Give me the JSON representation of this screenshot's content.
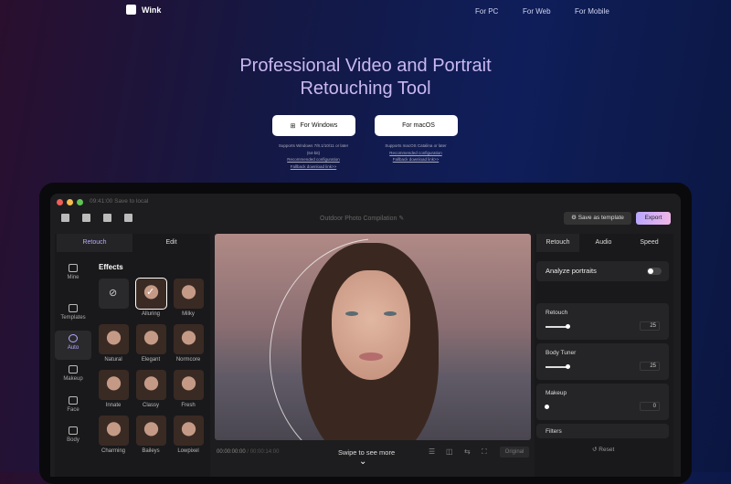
{
  "brand": {
    "name": "Wink"
  },
  "nav": [
    "For PC",
    "For Web",
    "For Mobile"
  ],
  "hero": {
    "line1": "Professional Video and Portrait",
    "line2": "Retouching Tool"
  },
  "downloads": [
    {
      "label": "For Windows",
      "icon": "windows-icon",
      "support": "Supports Windows 7/8.1/10/11 or later (64-bit)",
      "config": "Recommended configuration",
      "fallback": "Fallback download link>>"
    },
    {
      "label": "For macOS",
      "icon": "apple-icon",
      "support": "Supports macOS Catalina or later",
      "config": "Recommended configuration",
      "fallback": "Fallback download link>>"
    }
  ],
  "app": {
    "status": "09:41:00 Save to local",
    "project_title": "Outdoor Photo Compilation",
    "save_template": "Save as template",
    "export": "Export",
    "left_tabs": [
      "Retouch",
      "Edit"
    ],
    "sidebar": [
      "Mine",
      "Templates",
      "Auto",
      "Makeup",
      "Face",
      "Body"
    ],
    "effects_title": "Effects",
    "effects": [
      "",
      "Alluring",
      "Milky",
      "Natural",
      "Elegant",
      "Normcore",
      "Innate",
      "Classy",
      "Fresh",
      "Charming",
      "Baileys",
      "Lowpixel"
    ],
    "timecode": "00:00:00:00",
    "duration": "/ 00:00:14:00",
    "original": "Original",
    "right_tabs": [
      "Retouch",
      "Audio",
      "Speed"
    ],
    "analyze": "Analyze portraits",
    "panels": [
      {
        "label": "Retouch",
        "value": "25",
        "level": 0.25
      },
      {
        "label": "Body Tuner",
        "value": "25",
        "level": 0.25
      },
      {
        "label": "Makeup",
        "value": "0",
        "level": 0
      }
    ],
    "filters": "Filters",
    "reset": "Reset"
  },
  "swipe": "Swipe to see more",
  "colors": {
    "accent": "#c7a6f5",
    "export": "#b9a8ff"
  }
}
